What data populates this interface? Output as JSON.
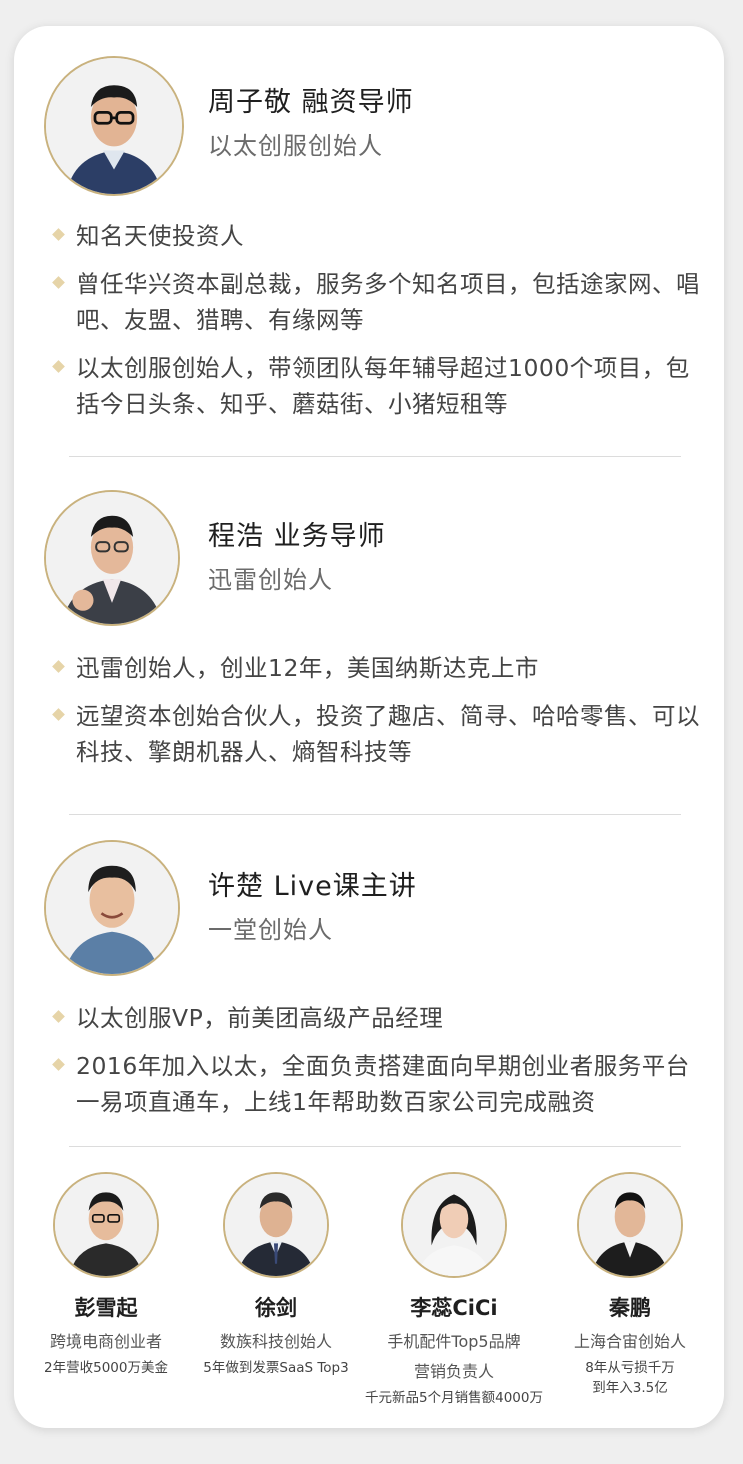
{
  "mentors": [
    {
      "name": "周子敬 融资导师",
      "title": "以太创服创始人",
      "bullets": [
        "知名天使投资人",
        "曾任华兴资本副总裁，服务多个知名项目，包括途家网、唱吧、友盟、猎聘、有缘网等",
        "以太创服创始人，带领团队每年辅导超过1000个项目，包括今日头条、知乎、蘑菇街、小猪短租等"
      ]
    },
    {
      "name": "程浩 业务导师",
      "title": "迅雷创始人",
      "bullets": [
        "迅雷创始人，创业12年，美国纳斯达克上市",
        "远望资本创始合伙人，投资了趣店、简寻、哈哈零售、可以科技、擎朗机器人、熵智科技等"
      ]
    },
    {
      "name": "许楚 Live课主讲",
      "title": "一堂创始人",
      "bullets": [
        "以太创服VP，前美团高级产品经理",
        "2016年加入以太，全面负责搭建面向早期创业者服务平台一易项直通车，上线1年帮助数百家公司完成融资"
      ]
    }
  ],
  "speakers": [
    {
      "name": "彭雪起",
      "line1": "跨境电商创业者",
      "line2": "2年营收5000万美金"
    },
    {
      "name": "徐剑",
      "line1": "数族科技创始人",
      "line2": "5年做到发票SaaS Top3"
    },
    {
      "name": "李蕊CiCi",
      "line1": "手机配件Top5品牌",
      "line1b": "营销负责人",
      "line2": "千元新品5个月销售额4000万"
    },
    {
      "name": "秦鹏",
      "line1": "上海合宙创始人",
      "line2": "8年从亏损千万",
      "line2b": "到年入3.5亿"
    }
  ],
  "colors": {
    "accent_gold": "#c9b27e",
    "diamond": "#e6d4a8",
    "divider": "#dcdcdc"
  }
}
